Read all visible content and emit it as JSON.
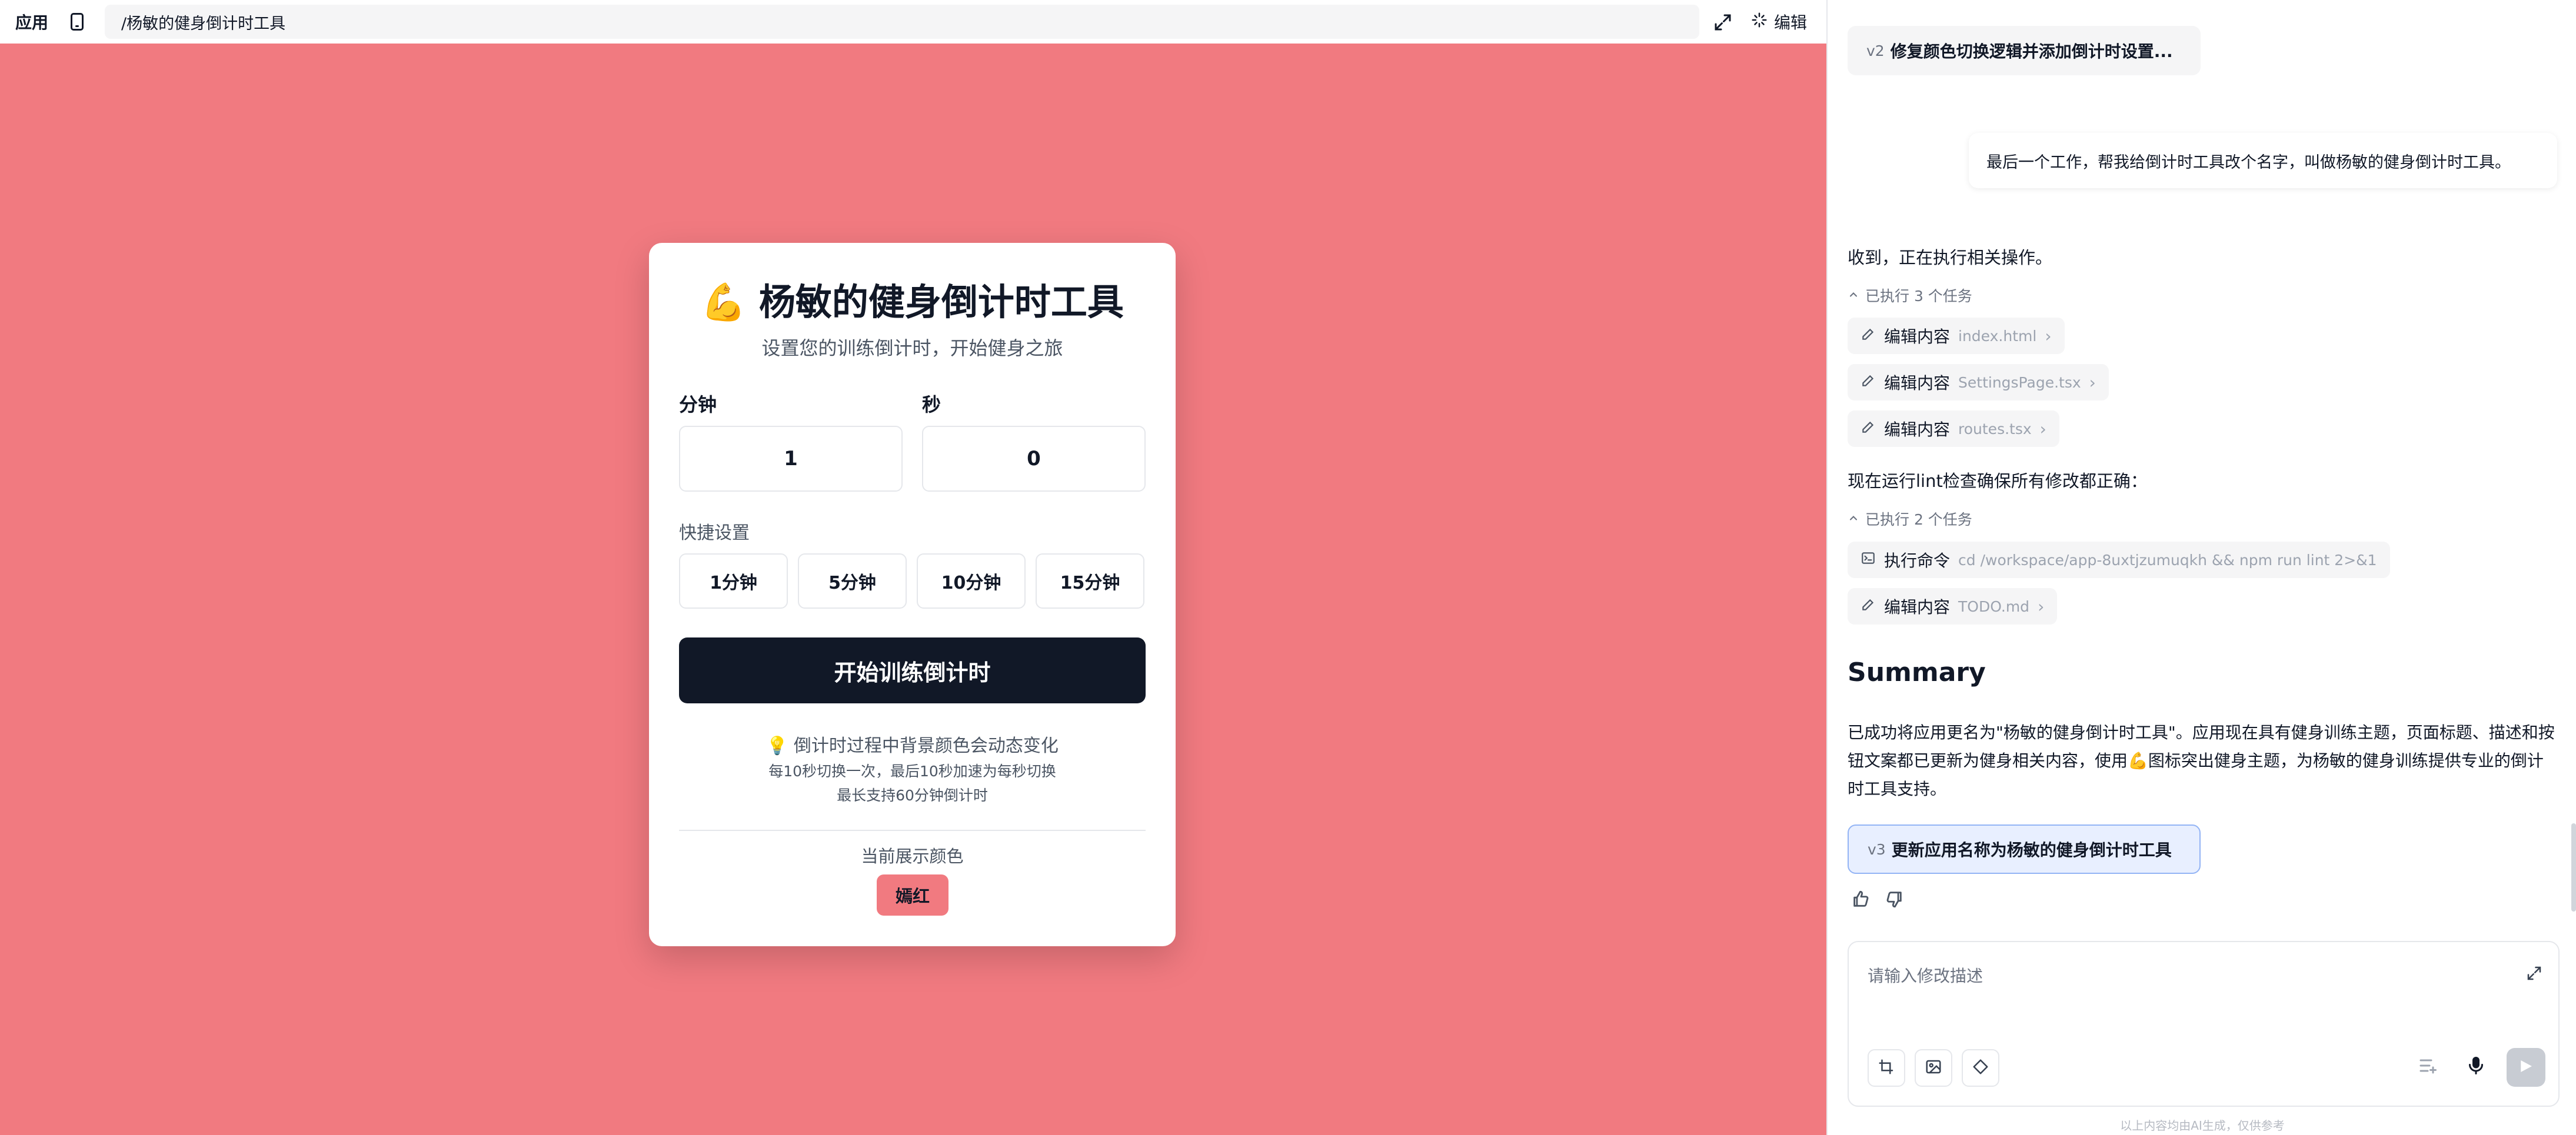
{
  "topbar": {
    "app_label": "应用",
    "url_path": "/杨敏的健身倒计时工具",
    "edit_label": "编辑"
  },
  "card": {
    "title": "💪 杨敏的健身倒计时工具",
    "subtitle": "设置您的训练倒计时，开始健身之旅",
    "minutes_label": "分钟",
    "minutes_value": "1",
    "seconds_label": "秒",
    "seconds_value": "0",
    "quick_label": "快捷设置",
    "quick_options": [
      "1分钟",
      "5分钟",
      "10分钟",
      "15分钟"
    ],
    "start_button": "开始训练倒计时",
    "tip_main": "💡 倒计时过程中背景颜色会动态变化",
    "tip_sub1": "每10秒切换一次，最后10秒加速为每秒切换",
    "tip_sub2": "最长支持60分钟倒计时",
    "current_color_label": "当前展示颜色",
    "current_color_name": "嫣红",
    "current_color_hex": "#f17a80"
  },
  "chat": {
    "version_v2_tag": "v2",
    "version_v2_title": "修复颜色切换逻辑并添加倒计时设置...",
    "user_message": "最后一个工作，帮我给倒计时工具改个名字，叫做杨敏的健身倒计时工具。",
    "reply_intro": "收到，正在执行相关操作。",
    "exec_group1": "已执行 3 个任务",
    "tasks1": [
      {
        "action": "编辑内容",
        "file": "index.html"
      },
      {
        "action": "编辑内容",
        "file": "SettingsPage.tsx"
      },
      {
        "action": "编辑内容",
        "file": "routes.tsx"
      }
    ],
    "lint_note": "现在运行lint检查确保所有修改都正确：",
    "exec_group2": "已执行 2 个任务",
    "task_command": {
      "action": "执行命令",
      "file": "cd /workspace/app-8uxtjzumuqkh && npm run lint 2>&1"
    },
    "task_todo": {
      "action": "编辑内容",
      "file": "TODO.md"
    },
    "summary_title": "Summary",
    "summary_text": "已成功将应用更名为\"杨敏的健身倒计时工具\"。应用现在具有健身训练主题，页面标题、描述和按钮文案都已更新为健身相关内容，使用💪图标突出健身主题，为杨敏的健身训练提供专业的倒计时工具支持。",
    "version_v3_tag": "v3",
    "version_v3_title": "更新应用名称为杨敏的健身倒计时工具",
    "input_placeholder": "请输入修改描述",
    "footer_note": "以上内容均由AI生成，仅供参考"
  },
  "colors": {
    "page_background": "#f17a80",
    "primary_button": "#111827",
    "accent_blue": "#93b4f5"
  }
}
